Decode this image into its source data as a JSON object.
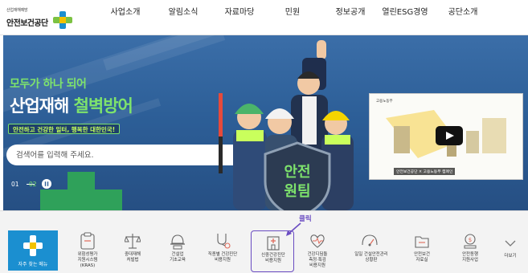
{
  "header": {
    "logo_sub": "산업재해예방",
    "logo_main": "안전보건공단",
    "nav": [
      "사업소개",
      "알림소식",
      "자료마당",
      "민원",
      "정보공개",
      "열린ESG경영",
      "공단소개"
    ]
  },
  "hero": {
    "slogan_line1": "모두가 하나 되어",
    "slogan_line2_a": "산업재해",
    "slogan_line2_b": "철벽방어",
    "slogan_line3": "안전하고 건강한 일터, 행복한 대한민국!",
    "search_placeholder": "검색어를 입력해 주세요.",
    "pager": {
      "page1": "01",
      "page2": "02"
    },
    "shield_text_line1": "안전",
    "shield_text_line2": "원팀",
    "video": {
      "caption": "안전보건공단 × 고용노동부 캠페인",
      "flag": "고용노동부"
    }
  },
  "quick_menu": {
    "title": "자주 찾는 메뉴",
    "items": [
      {
        "label": "위험성평가\n지원시스템\n(KRAS)",
        "icon": "clipboard-icon"
      },
      {
        "label": "중대재해\n처벌법",
        "icon": "scales-icon"
      },
      {
        "label": "건설업\n기초교육",
        "icon": "helmet-icon"
      },
      {
        "label": "직종별 건강진단\n비용지원",
        "icon": "stethoscope-icon"
      },
      {
        "label": "신중건강진단\n비용지원",
        "icon": "hospital-icon"
      },
      {
        "label": "건강디딤돌\n측정·특검\n비용지원",
        "icon": "heart-pulse-icon"
      },
      {
        "label": "일일 건설안전관리\n상황판",
        "icon": "gauge-icon"
      },
      {
        "label": "안전보건\n자료실",
        "icon": "folder-icon"
      },
      {
        "label": "안전동행\n지원사업",
        "icon": "coin-icon"
      }
    ],
    "more_label": "더보기"
  },
  "annotation": {
    "click_label": "클릭"
  },
  "colors": {
    "accent_green": "#7ee36c",
    "quick_blue": "#1b8fd0",
    "highlight_purple": "#6a4cc2"
  }
}
